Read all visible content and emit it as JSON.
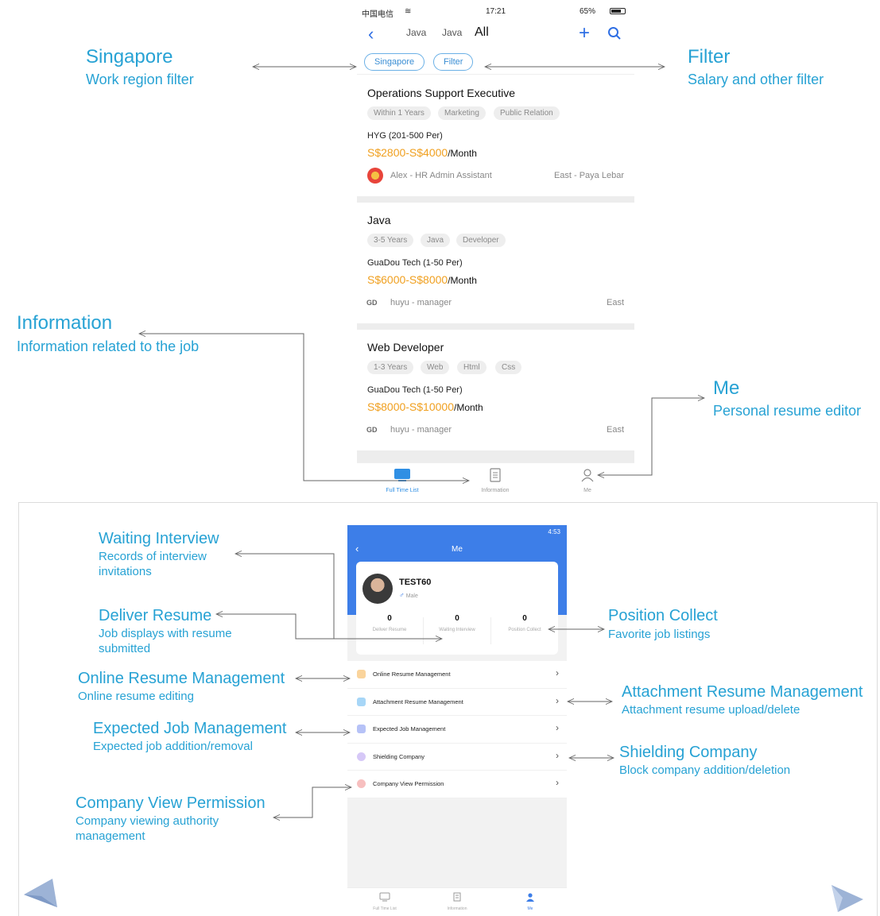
{
  "colors": {
    "annotation": "#27a2d4",
    "accent": "#2f6fe4",
    "salary": "#f0a020",
    "header_blue": "#3d7ee8"
  },
  "annotations": {
    "singapore": {
      "title": "Singapore",
      "subtitle": "Work region filter"
    },
    "filter": {
      "title": "Filter",
      "subtitle": "Salary and other filter"
    },
    "information": {
      "title": "Information",
      "subtitle": "Information related to the job"
    },
    "me": {
      "title": "Me",
      "subtitle": "Personal resume editor"
    },
    "waiting_interview": {
      "title": "Waiting Interview",
      "subtitle": "Records of interview invitations"
    },
    "deliver_resume": {
      "title": "Deliver Resume",
      "subtitle": "Job displays with resume submitted"
    },
    "online_resume": {
      "title": "Online Resume Management",
      "subtitle": "Online resume editing"
    },
    "expected_job": {
      "title": "Expected Job Management",
      "subtitle": "Expected job addition/removal"
    },
    "company_view": {
      "title": "Company View Permission",
      "subtitle": "Company viewing authority management"
    },
    "position_collect": {
      "title": "Position Collect",
      "subtitle": "Favorite job listings"
    },
    "attachment_resume": {
      "title": "Attachment Resume Management",
      "subtitle": "Attachment resume upload/delete"
    },
    "shielding": {
      "title": "Shielding Company",
      "subtitle": "Block company addition/deletion"
    }
  },
  "phone1": {
    "status": {
      "carrier": "中国电信",
      "time": "17:21",
      "battery": "65%"
    },
    "nav": {
      "tabs": [
        "Java",
        "Java",
        "All"
      ]
    },
    "filters": [
      "Singapore",
      "Filter"
    ],
    "jobs": [
      {
        "title": "Operations Support Executive",
        "tags": [
          "Within 1 Years",
          "Marketing",
          "Public Relation"
        ],
        "company": "HYG (201-500 Per)",
        "salary": "S$2800-S$4000",
        "unit": "/Month",
        "recruiter": "Alex - HR Admin Assistant",
        "location": "East - Paya Lebar"
      },
      {
        "title": "Java",
        "tags": [
          "3-5 Years",
          "Java",
          "Developer"
        ],
        "company": "GuaDou Tech (1-50 Per)",
        "salary": "S$6000-S$8000",
        "unit": "/Month",
        "recruiter": "huyu - manager",
        "location": "East",
        "logo": "GD"
      },
      {
        "title": "Web Developer",
        "tags": [
          "1-3 Years",
          "Web",
          "Html",
          "Css"
        ],
        "company": "GuaDou Tech (1-50 Per)",
        "salary": "S$8000-S$10000",
        "unit": "/Month",
        "recruiter": "huyu - manager",
        "location": "East",
        "logo": "GD"
      }
    ],
    "tabbar": [
      "Full Time List",
      "Information",
      "Me"
    ]
  },
  "phone2": {
    "status": "4:53",
    "title": "Me",
    "profile": {
      "name": "TEST60",
      "gender_symbol": "♂",
      "gender": "Male"
    },
    "stats": [
      {
        "value": "0",
        "label": "Deliver Resume"
      },
      {
        "value": "0",
        "label": "Waiting Interview"
      },
      {
        "value": "0",
        "label": "Position Collect"
      }
    ],
    "menu": [
      "Online Resume Management",
      "Attachment Resume Management",
      "Expected Job Management",
      "Shielding Company",
      "Company View Permission"
    ],
    "tabbar": [
      "Full Time List",
      "Information",
      "Me"
    ]
  }
}
